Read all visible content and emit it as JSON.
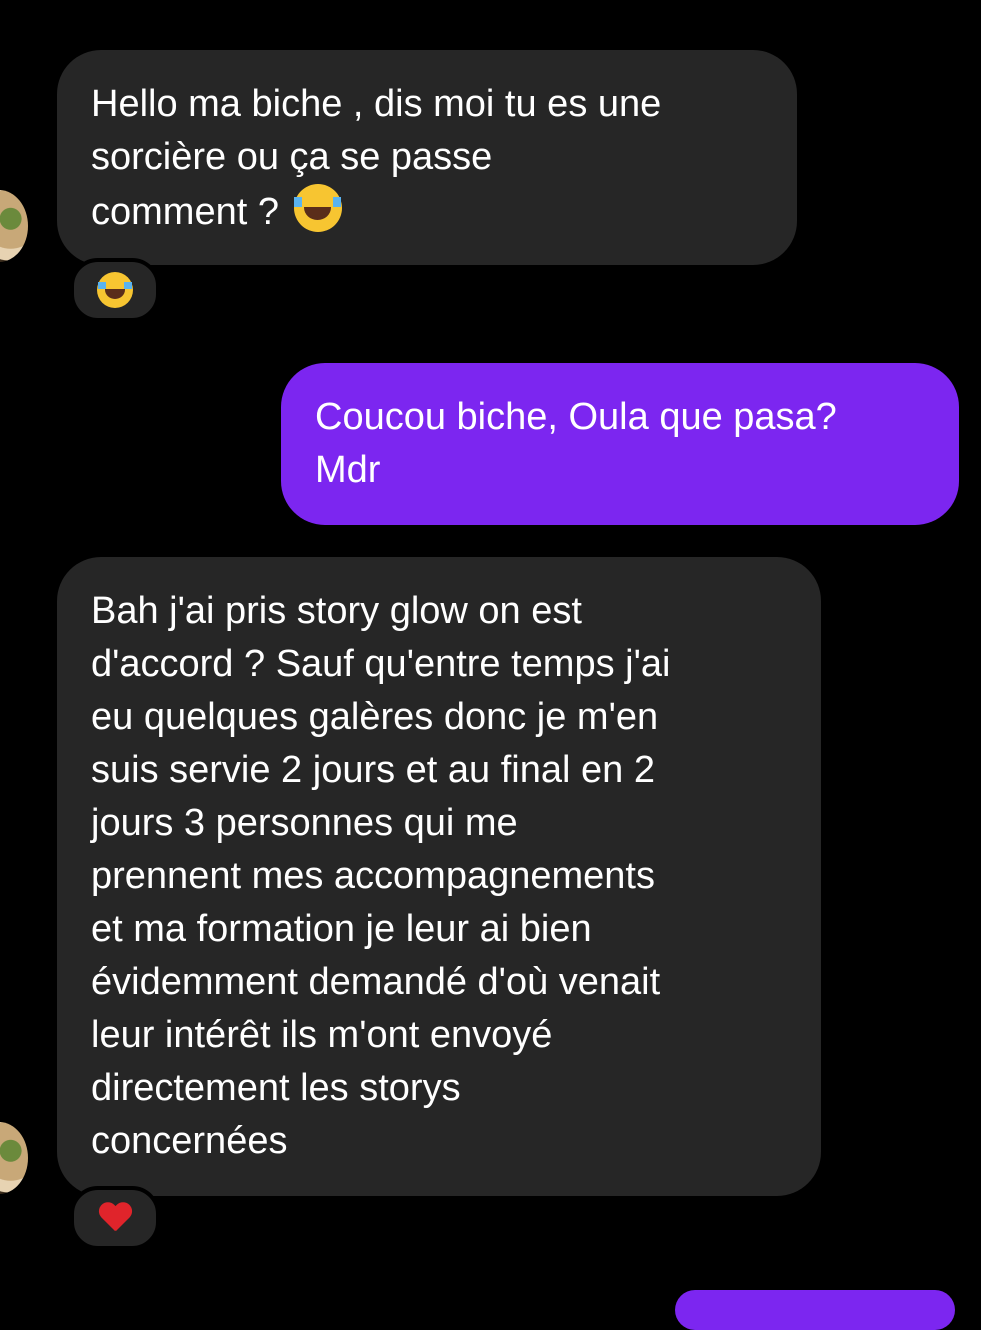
{
  "messages": [
    {
      "direction": "incoming",
      "text": "Hello ma biche , dis moi tu es une\nsorcière ou ça se passe\ncomment ? ",
      "emoji_icon": "face-with-tears-of-joy-icon",
      "reaction_icon": "face-with-tears-of-joy-icon"
    },
    {
      "direction": "outgoing",
      "text": "Coucou biche, Oula que pasa?\nMdr"
    },
    {
      "direction": "incoming",
      "text": "Bah j'ai pris story glow on est\nd'accord ? Sauf qu'entre temps j'ai\neu quelques galères donc je m'en\nsuis servie 2 jours et au final en 2\njours 3 personnes qui me\nprennent mes accompagnements\net ma formation je leur ai bien\névidemment demandé d'où venait\nleur intérêt ils m'ont envoyé\ndirectement les storys\nconcernées",
      "reaction_icon": "red-heart-icon"
    }
  ],
  "colors": {
    "background": "#000000",
    "incoming_bubble": "#262626",
    "outgoing_bubble": "#7c26f0",
    "text": "#ffffff"
  }
}
